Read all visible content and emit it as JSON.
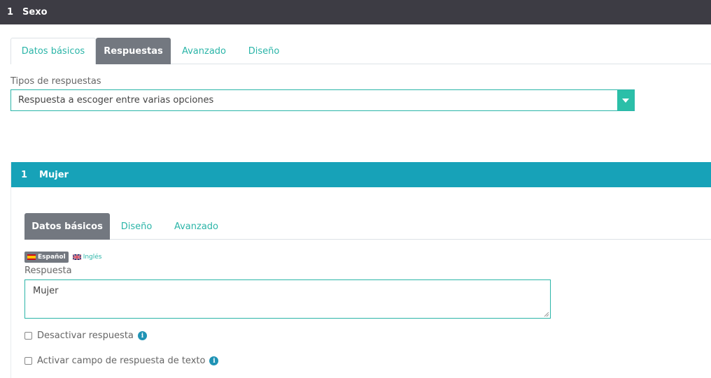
{
  "header": {
    "number": "1",
    "title": "Sexo"
  },
  "question_tabs": [
    {
      "label": "Datos básicos"
    },
    {
      "label": "Respuestas"
    },
    {
      "label": "Avanzado"
    },
    {
      "label": "Diseño"
    }
  ],
  "response_type": {
    "label": "Tipos de respuestas",
    "selected": "Respuesta a escoger entre varias opciones"
  },
  "answer": {
    "number": "1",
    "title": "Mujer",
    "tabs": [
      {
        "label": "Datos básicos"
      },
      {
        "label": "Diseño"
      },
      {
        "label": "Avanzado"
      }
    ],
    "languages": [
      {
        "label": "Español",
        "flag": "spain-flag-icon"
      },
      {
        "label": "Inglés",
        "flag": "uk-flag-icon"
      }
    ],
    "field_label": "Respuesta",
    "field_value": "Mujer",
    "disable_label": "Desactivar respuesta",
    "text_field_label": "Activar campo de respuesta de texto"
  },
  "colors": {
    "topbar": "#3d3c44",
    "accent": "#2bb5a8",
    "card_header": "#17a2b8",
    "active_tab": "#737880"
  }
}
